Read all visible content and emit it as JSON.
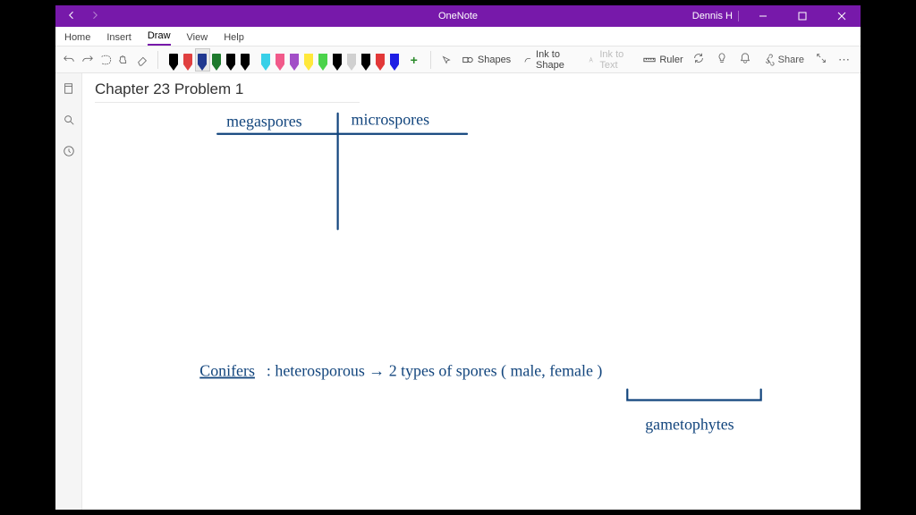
{
  "titlebar": {
    "app_name": "OneNote",
    "user": "Dennis H"
  },
  "menu": {
    "home": "Home",
    "insert": "Insert",
    "draw": "Draw",
    "view": "View",
    "help": "Help",
    "active": "draw"
  },
  "toolbar": {
    "pen_colors": [
      "#000000",
      "#e04040",
      "#203890",
      "#1e7a2d",
      "#000000",
      "#000000"
    ],
    "highlighter_colors": [
      "#39d0e8",
      "#f15a8a",
      "#a24ec7",
      "#ffe83b",
      "#4bd34b",
      "#000000",
      "#d0d0d0",
      "#000000",
      "#e23838",
      "#1e1ee4"
    ],
    "selected_pen_index": 2,
    "shapes": "Shapes",
    "ink_to_shape": "Ink to Shape",
    "ink_to_text": "Ink to Text",
    "ruler": "Ruler",
    "share": "Share"
  },
  "page": {
    "title": "Chapter 23 Problem 1",
    "ink": {
      "col_left": "megaspores",
      "col_right": "microspores",
      "line2_a": "Conifers",
      "line2_b": ": heterosporous → 2 types of spores ( male, female )",
      "line3": "gametophytes"
    }
  }
}
